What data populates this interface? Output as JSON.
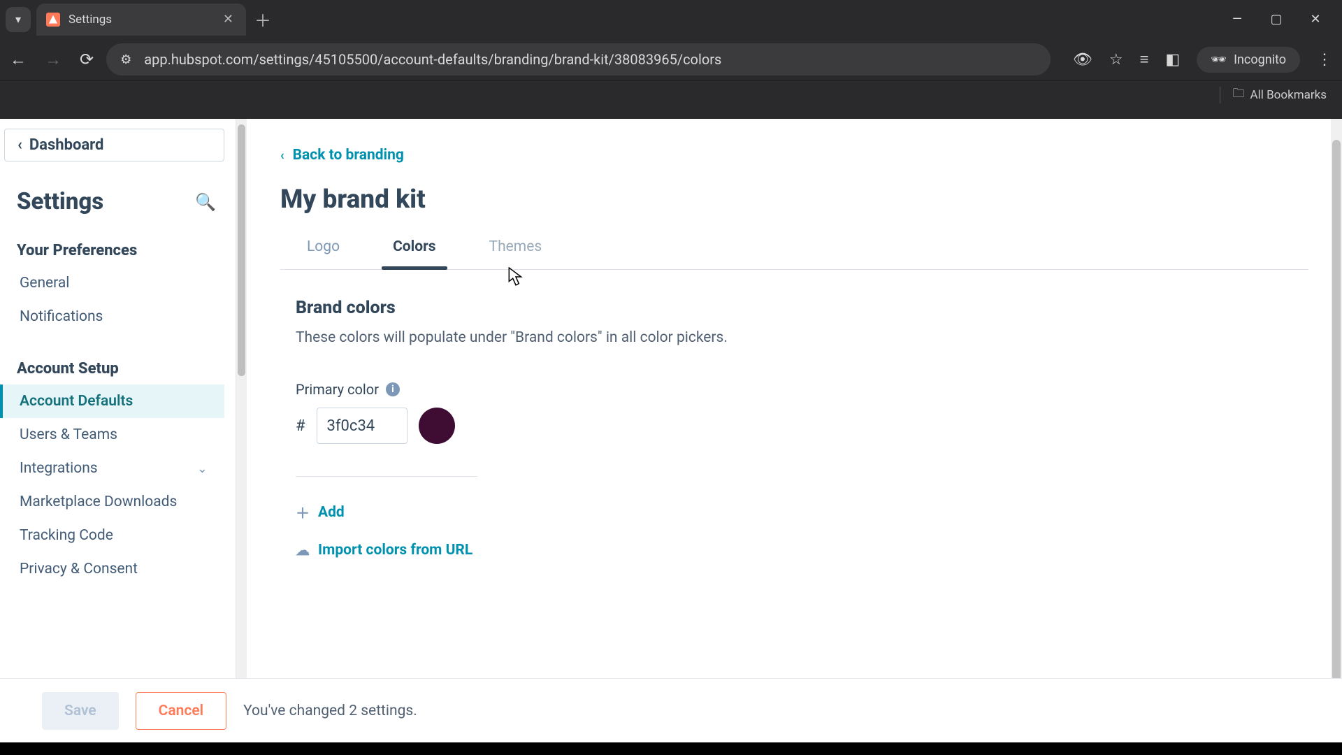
{
  "browser": {
    "tab_title": "Settings",
    "url": "app.hubspot.com/settings/45105500/account-defaults/branding/brand-kit/38083965/colors",
    "incognito_label": "Incognito",
    "all_bookmarks": "All Bookmarks"
  },
  "sidebar": {
    "dashboard": "Dashboard",
    "settings_title": "Settings",
    "groups": [
      {
        "title": "Your Preferences",
        "items": [
          "General",
          "Notifications"
        ]
      },
      {
        "title": "Account Setup",
        "items": [
          "Account Defaults",
          "Users & Teams",
          "Integrations",
          "Marketplace Downloads",
          "Tracking Code",
          "Privacy & Consent"
        ]
      }
    ]
  },
  "main": {
    "back": "Back to branding",
    "title": "My brand kit",
    "tabs": [
      "Logo",
      "Colors",
      "Themes"
    ],
    "section_title": "Brand colors",
    "section_desc": "These colors will populate under \"Brand colors\" in all color pickers.",
    "primary_label": "Primary color",
    "hash": "#",
    "hex_value": "3f0c34",
    "swatch_color": "#3f0c34",
    "add": "Add",
    "import": "Import colors from URL"
  },
  "footer": {
    "save": "Save",
    "cancel": "Cancel",
    "status": "You've changed 2 settings."
  }
}
